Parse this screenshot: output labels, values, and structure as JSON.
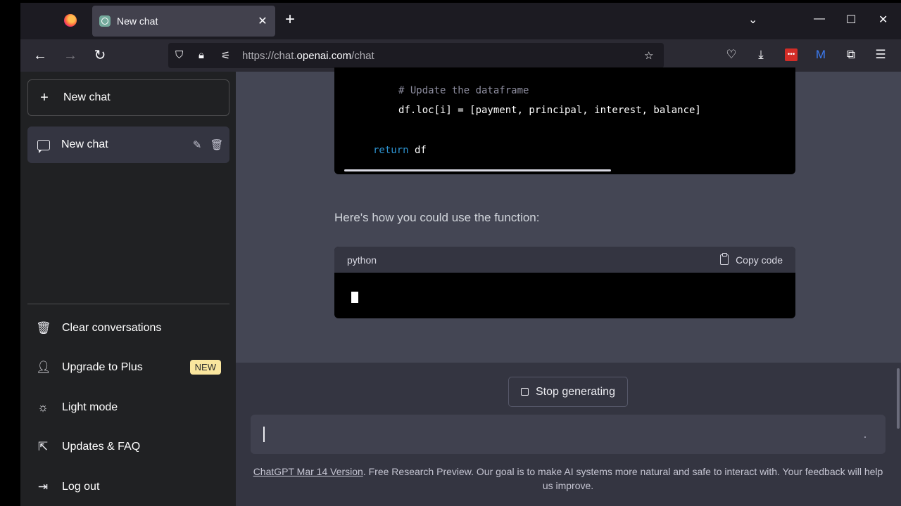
{
  "browser": {
    "tab_title": "New chat",
    "tab_close": "✕",
    "new_tab": "+",
    "list_tabs": "⌄",
    "minimize": "—",
    "maximize": "☐",
    "close": "✕",
    "url_prefix": "https://chat.",
    "url_domain": "openai.com",
    "url_suffix": "/chat"
  },
  "sidebar": {
    "new_chat_label": "New chat",
    "chat_items": [
      {
        "label": "New chat"
      }
    ],
    "menu": {
      "clear": "Clear conversations",
      "upgrade": "Upgrade to Plus",
      "upgrade_badge": "NEW",
      "light_mode": "Light mode",
      "updates": "Updates & FAQ",
      "logout": "Log out"
    }
  },
  "conversation": {
    "code1": {
      "comment": "# Update the dataframe",
      "assign": "df.loc[i] = [payment, principal, interest, balance]",
      "return_kw": "return",
      "return_val": " df"
    },
    "prose": "Here's how you could use the function:",
    "code2": {
      "language": "python",
      "copy_label": "Copy code"
    }
  },
  "composer": {
    "stop_label": "Stop generating",
    "footer_link": "ChatGPT Mar 14 Version",
    "footer_text": ". Free Research Preview. Our goal is to make AI systems more natural and safe to interact with. Your feedback will help us improve."
  },
  "colors": {
    "sidebar_bg": "#202123",
    "main_bg": "#444654",
    "composer_bg": "#343541",
    "badge_bg": "#fae69e",
    "keyword": "#2e95d3"
  }
}
